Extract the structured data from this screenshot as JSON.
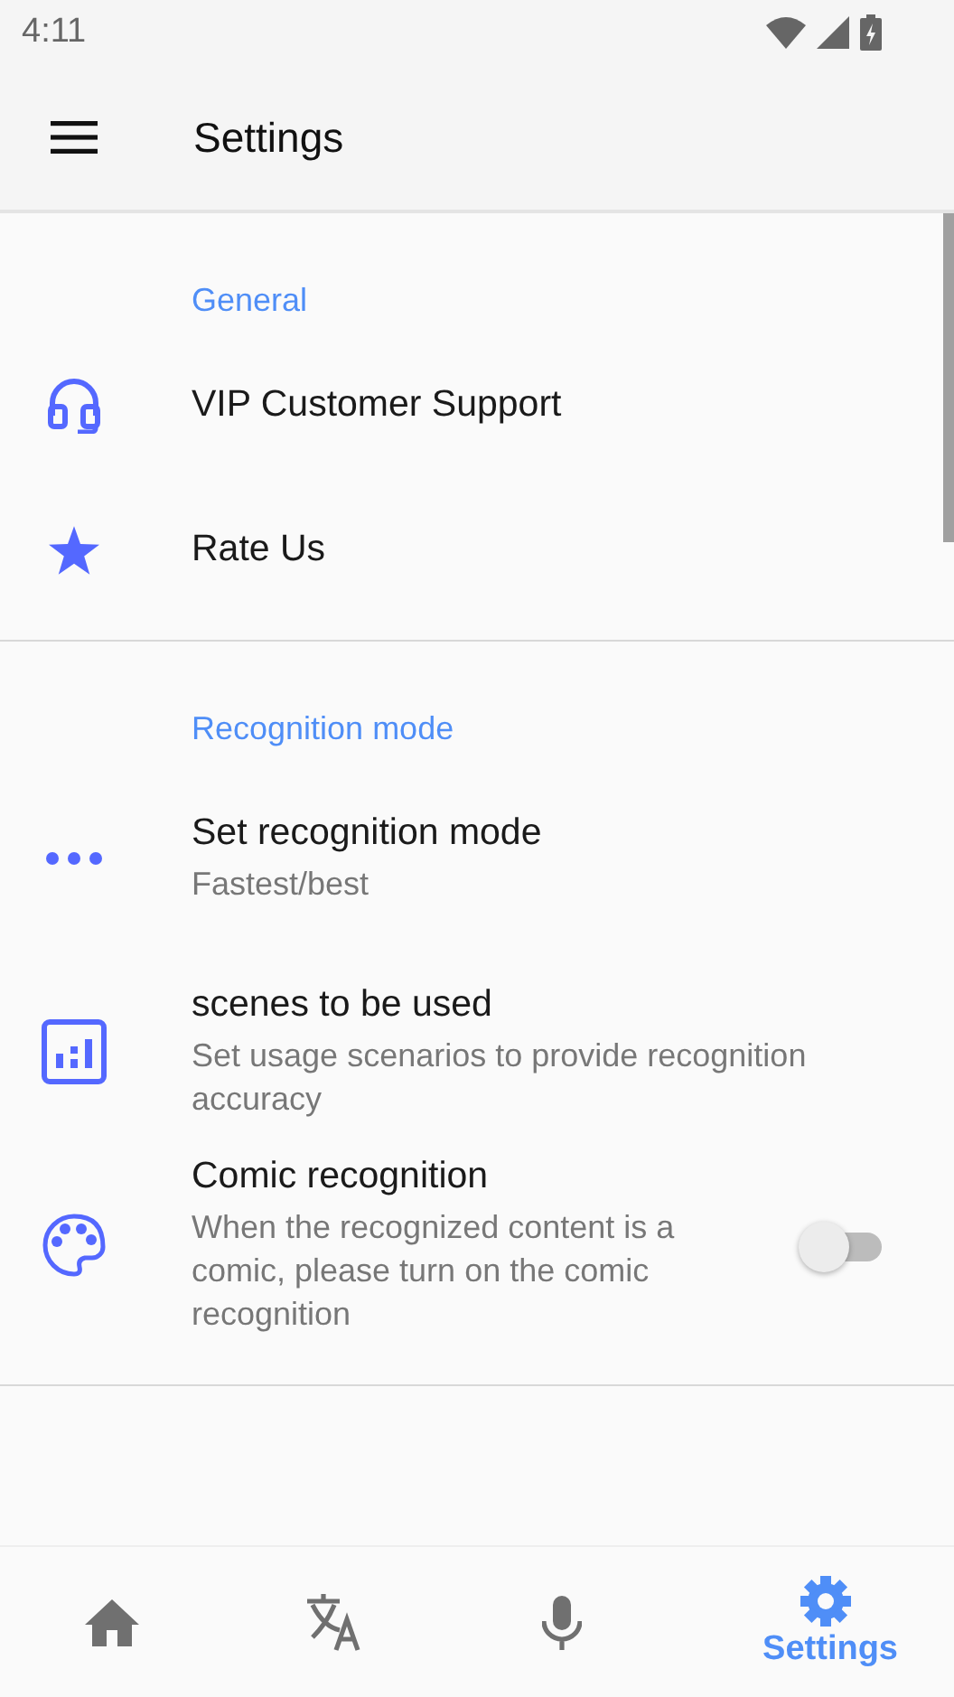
{
  "status_bar": {
    "time": "4:11"
  },
  "app_bar": {
    "title": "Settings"
  },
  "sections": [
    {
      "header": "General",
      "items": [
        {
          "kind": "plain",
          "title": "VIP Customer Support"
        },
        {
          "kind": "plain",
          "title": "Rate Us"
        }
      ]
    },
    {
      "header": "Recognition mode",
      "items": [
        {
          "kind": "plain",
          "title": "Set recognition mode",
          "subtitle": "Fastest/best"
        },
        {
          "kind": "plain",
          "title": "scenes to be used",
          "subtitle": "Set usage scenarios to provide recognition accuracy"
        },
        {
          "kind": "switch",
          "title": "Comic recognition",
          "subtitle": "When the recognized content is a comic, please turn on the comic recognition",
          "on": false
        }
      ]
    }
  ],
  "bottom_nav": [
    {
      "selected": false
    },
    {
      "selected": false
    },
    {
      "selected": false
    },
    {
      "label": "Settings",
      "selected": true
    }
  ]
}
